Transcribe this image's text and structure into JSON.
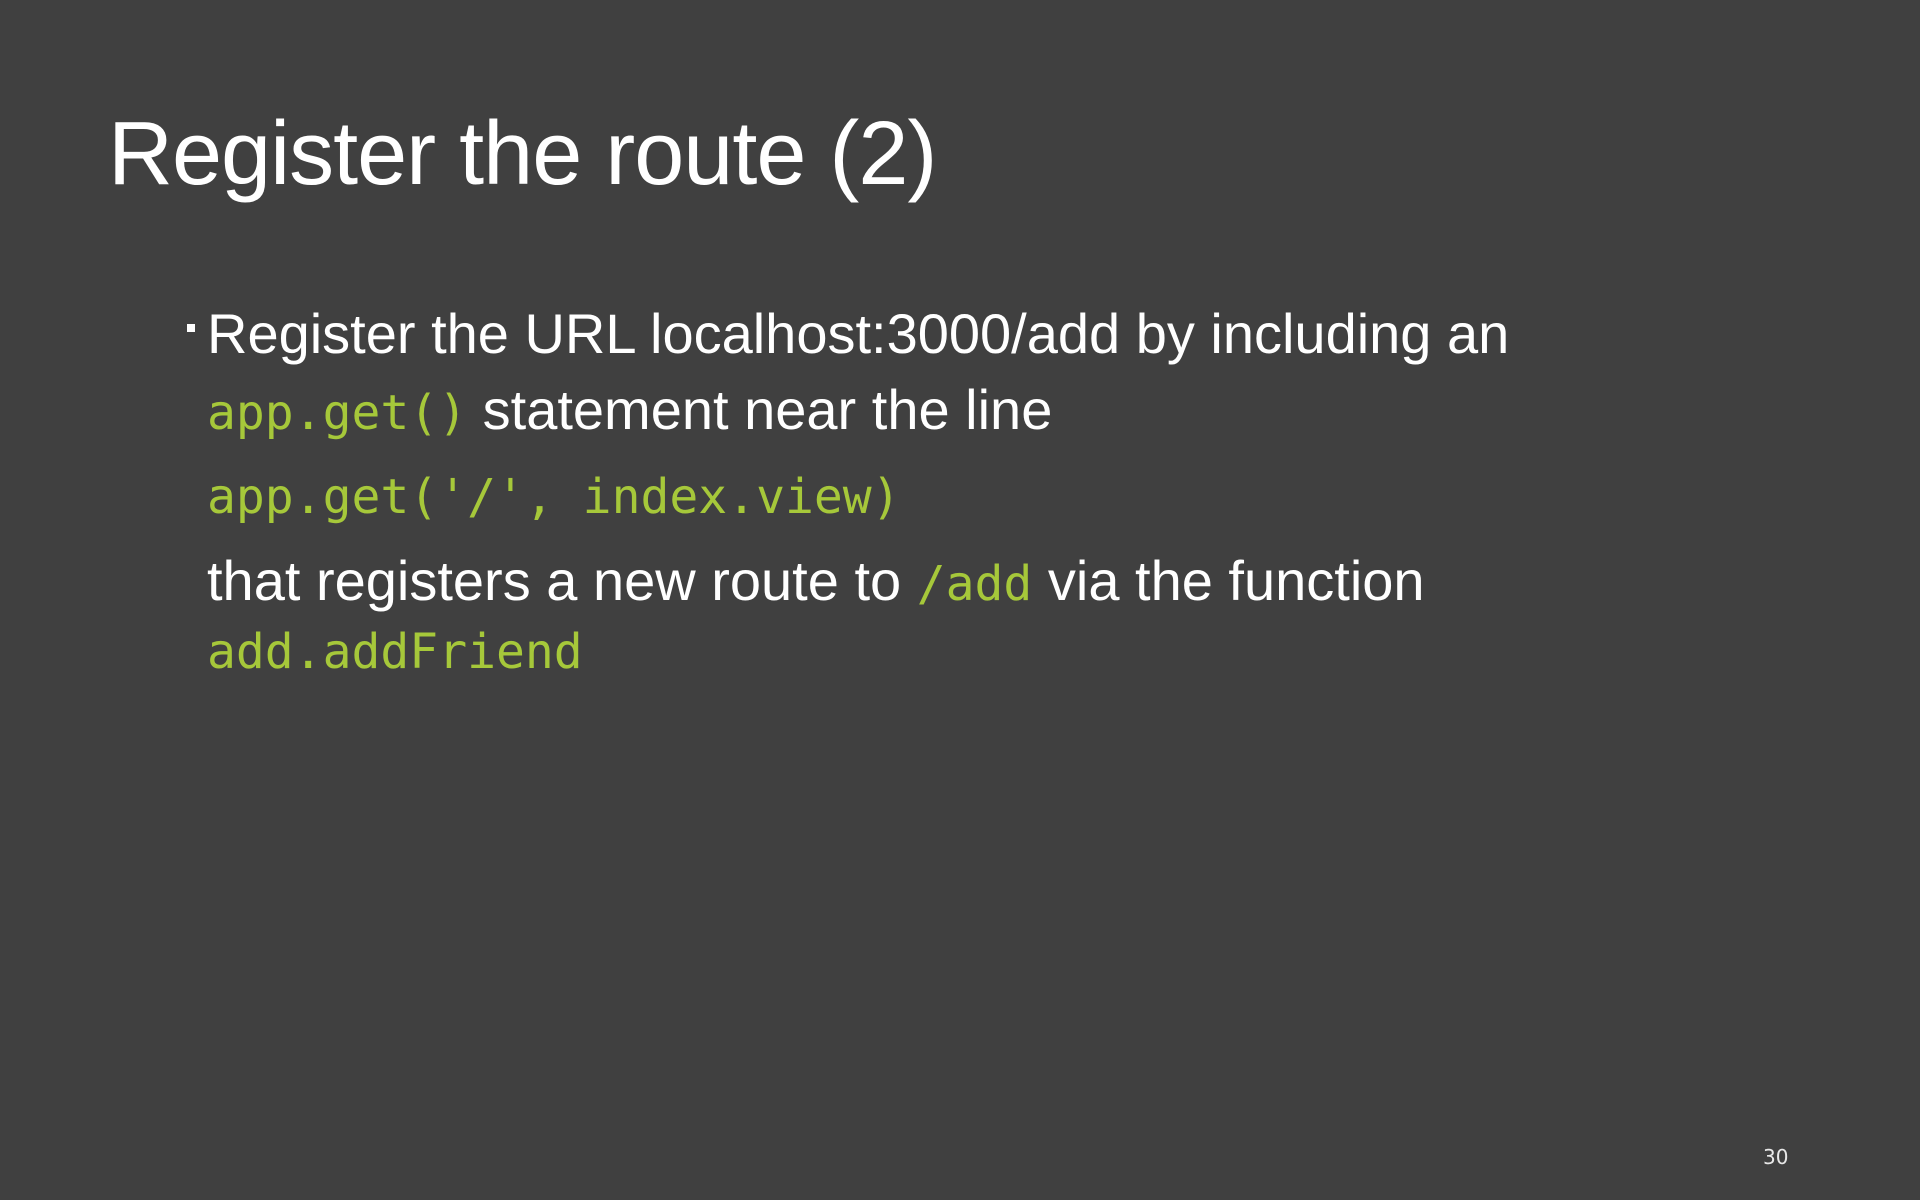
{
  "slide": {
    "title": "Register the route (2)",
    "bullet": {
      "line1": "Register the URL localhost:3000/add by including an",
      "code_inline_1": "app.get()",
      "line2_text": " statement near the line",
      "code_block": "app.get('/', index.view)",
      "line3_text": "that registers a new route to ",
      "code_inline_2": "/add",
      "line3_text_end": " via the function",
      "code_inline_3": "add.addFriend"
    },
    "page_number": "30",
    "colors": {
      "background": "#404040",
      "text": "#ffffff",
      "code": "#a6c83a"
    }
  }
}
